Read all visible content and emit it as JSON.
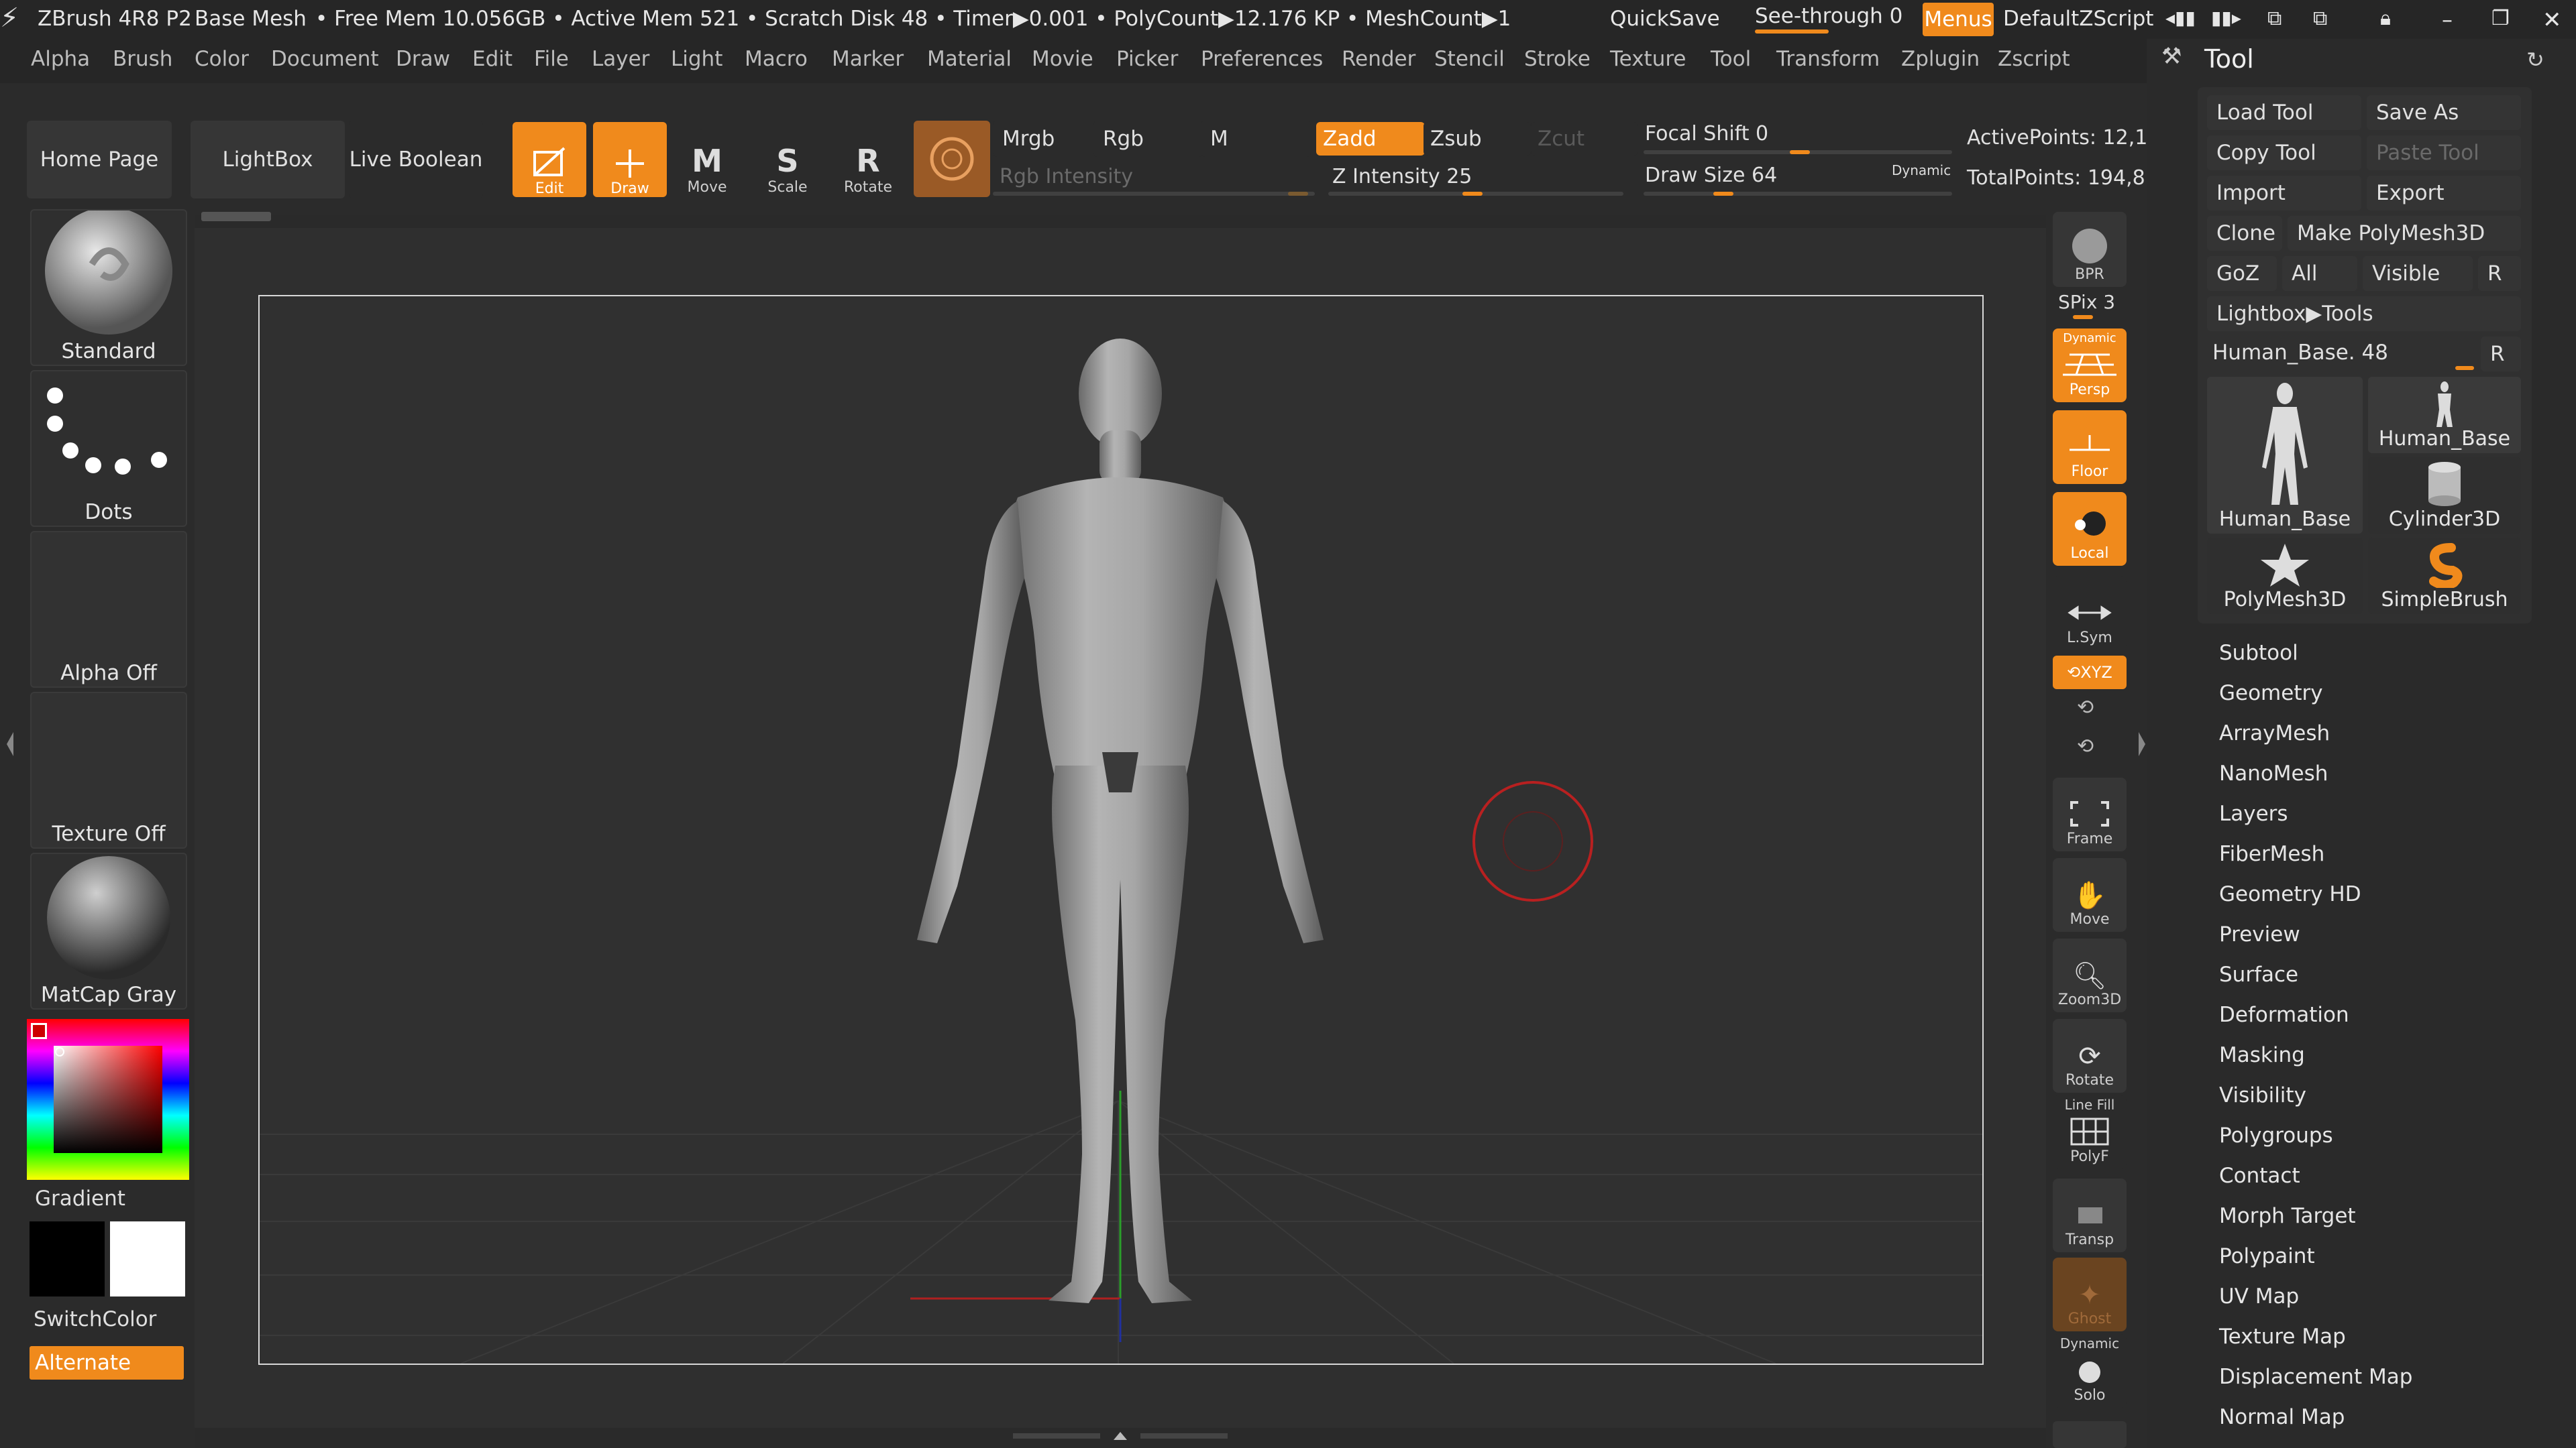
{
  "titlebar": {
    "app": "ZBrush 4R8 P2",
    "doc": "Base Mesh",
    "status": "• Free Mem 10.056GB • Active Mem 521 • Scratch Disk 48 •  Timer▶0.001 • PolyCount▶12.176 KP  • MeshCount▶1",
    "quicksave": "QuickSave",
    "see_through": "See-through  0",
    "menus": "Menus",
    "script": "DefaultZScript"
  },
  "menu": [
    "Alpha",
    "Brush",
    "Color",
    "Document",
    "Draw",
    "Edit",
    "File",
    "Layer",
    "Light",
    "Macro",
    "Marker",
    "Material",
    "Movie",
    "Picker",
    "Preferences",
    "Render",
    "Stencil",
    "Stroke",
    "Texture",
    "Tool",
    "Transform",
    "Zplugin",
    "Zscript"
  ],
  "toolbar": {
    "home": "Home Page",
    "lightbox": "LightBox",
    "live_boolean": "Live Boolean",
    "edit": "Edit",
    "draw": "Draw",
    "move": "Move",
    "scale": "Scale",
    "rotate": "Rotate",
    "mrgb": "Mrgb",
    "rgb": "Rgb",
    "m": "M",
    "rgb_intensity": "Rgb Intensity",
    "zadd": "Zadd",
    "zsub": "Zsub",
    "zcut": "Zcut",
    "z_intensity": "Z Intensity 25",
    "focal_shift": "Focal Shift 0",
    "draw_size": "Draw Size 64",
    "dynamic": "Dynamic",
    "active_points": "ActivePoints: 12,1",
    "total_points": "TotalPoints: 194,8"
  },
  "left": {
    "brush": "Standard",
    "stroke": "Dots",
    "alpha": "Alpha Off",
    "texture": "Texture Off",
    "material": "MatCap Gray",
    "gradient": "Gradient",
    "switch_color": "SwitchColor",
    "alternate": "Alternate"
  },
  "shelf": {
    "bpr": "BPR",
    "spix": "SPix 3",
    "dynamic": "Dynamic",
    "persp": "Persp",
    "floor": "Floor",
    "local": "Local",
    "lsym": "L.Sym",
    "xyz": "XYZ",
    "frame": "Frame",
    "move": "Move",
    "zoom3d": "Zoom3D",
    "rotate": "Rotate",
    "line_fill": "Line Fill",
    "polyf": "PolyF",
    "transp": "Transp",
    "ghost": "Ghost",
    "dynamic2": "Dynamic",
    "solo": "Solo"
  },
  "palette": {
    "title": "Tool",
    "load_tool": "Load Tool",
    "save_as": "Save As",
    "copy_tool": "Copy Tool",
    "paste_tool": "Paste Tool",
    "import": "Import",
    "export": "Export",
    "clone": "Clone",
    "make_polymesh": "Make PolyMesh3D",
    "goz": "GoZ",
    "all": "All",
    "visible": "Visible",
    "r": "R",
    "lightbox_tools": "Lightbox▶Tools",
    "current_tool": "Human_Base. 48",
    "tools": [
      "Human_Base",
      "Human_Base",
      "Cylinder3D",
      "PolyMesh3D",
      "SimpleBrush"
    ],
    "subpalettes": [
      "Subtool",
      "Geometry",
      "ArrayMesh",
      "NanoMesh",
      "Layers",
      "FiberMesh",
      "Geometry HD",
      "Preview",
      "Surface",
      "Deformation",
      "Masking",
      "Visibility",
      "Polygroups",
      "Contact",
      "Morph Target",
      "Polypaint",
      "UV Map",
      "Texture Map",
      "Displacement Map",
      "Normal Map"
    ]
  },
  "colors": {
    "accent": "#f08a1c",
    "background": "#2a2a2a",
    "brush_cursor": "#b82020"
  }
}
